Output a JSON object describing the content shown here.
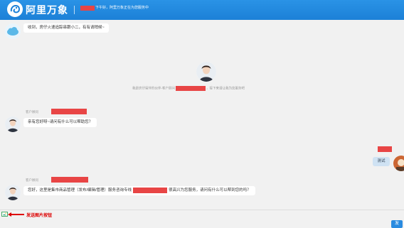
{
  "header": {
    "brand": "阿里万象",
    "status": "下午好，阿里万象正在为您服务中"
  },
  "messages": {
    "first": {
      "text": "收到，房仔火速追踪串跟小二，有有请稍候~"
    },
    "notice": {
      "prefix": "我是房仔留伴的伙伴-客户顾问",
      "suffix": "，接下来请让我为您服务吧"
    },
    "agent1": {
      "sender": "客户顾问",
      "text": "亲有您好呀~请问有什么可以帮助您？"
    },
    "user": {
      "text": "测试"
    },
    "agent2": {
      "sender": "客户顾问",
      "text_before": "您好，这里是集市商品管理（发布/编辑/管理）服务咨询专线",
      "text_after": "很高兴为您服务，请问有什么可以帮到您的吗？"
    }
  },
  "annotation": {
    "label": "发送图片按钮"
  },
  "send": {
    "label": "发"
  },
  "colors": {
    "header": "#1c80d7",
    "redaction": "#e84545",
    "annotation": "#dd0000"
  }
}
